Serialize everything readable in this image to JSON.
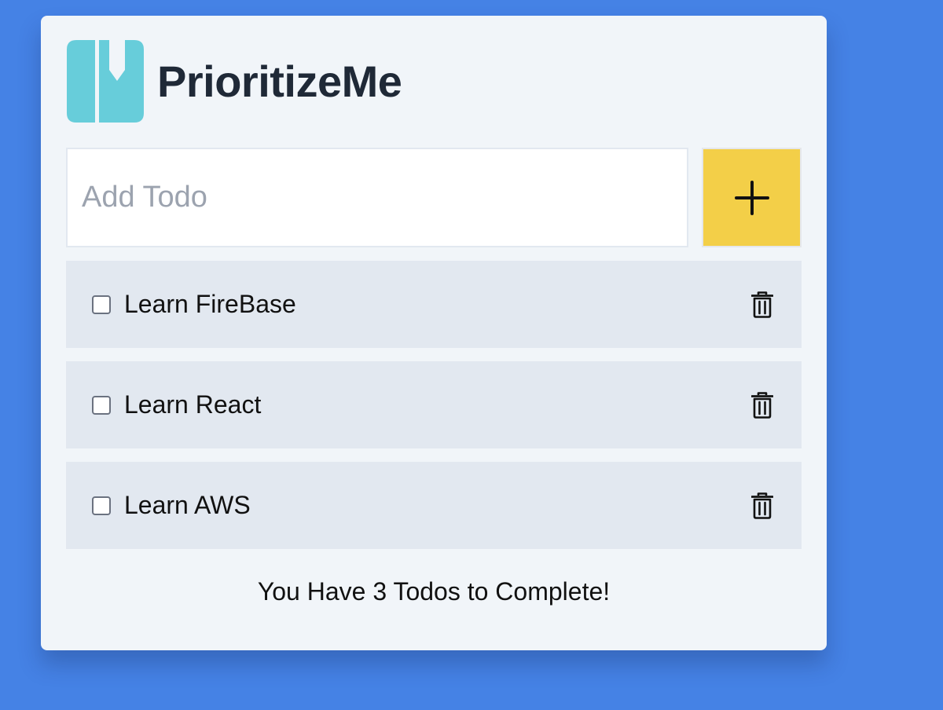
{
  "app": {
    "title": "PrioritizeMe",
    "logo_icon": "bookmark-logo-icon"
  },
  "add_todo": {
    "placeholder": "Add Todo",
    "value": "",
    "button_icon": "plus-icon"
  },
  "todos": [
    {
      "label": "Learn FireBase",
      "checked": false,
      "delete_icon": "trash-icon"
    },
    {
      "label": "Learn React",
      "checked": false,
      "delete_icon": "trash-icon"
    },
    {
      "label": "Learn AWS",
      "checked": false,
      "delete_icon": "trash-icon"
    }
  ],
  "footer": {
    "message": "You Have 3 Todos to Complete!"
  },
  "colors": {
    "background": "#4582e5",
    "card": "#f1f5f9",
    "logo": "#67cdda",
    "title": "#1f2937",
    "add_button": "#f3cf48",
    "todo_row": "#e2e8f0"
  }
}
